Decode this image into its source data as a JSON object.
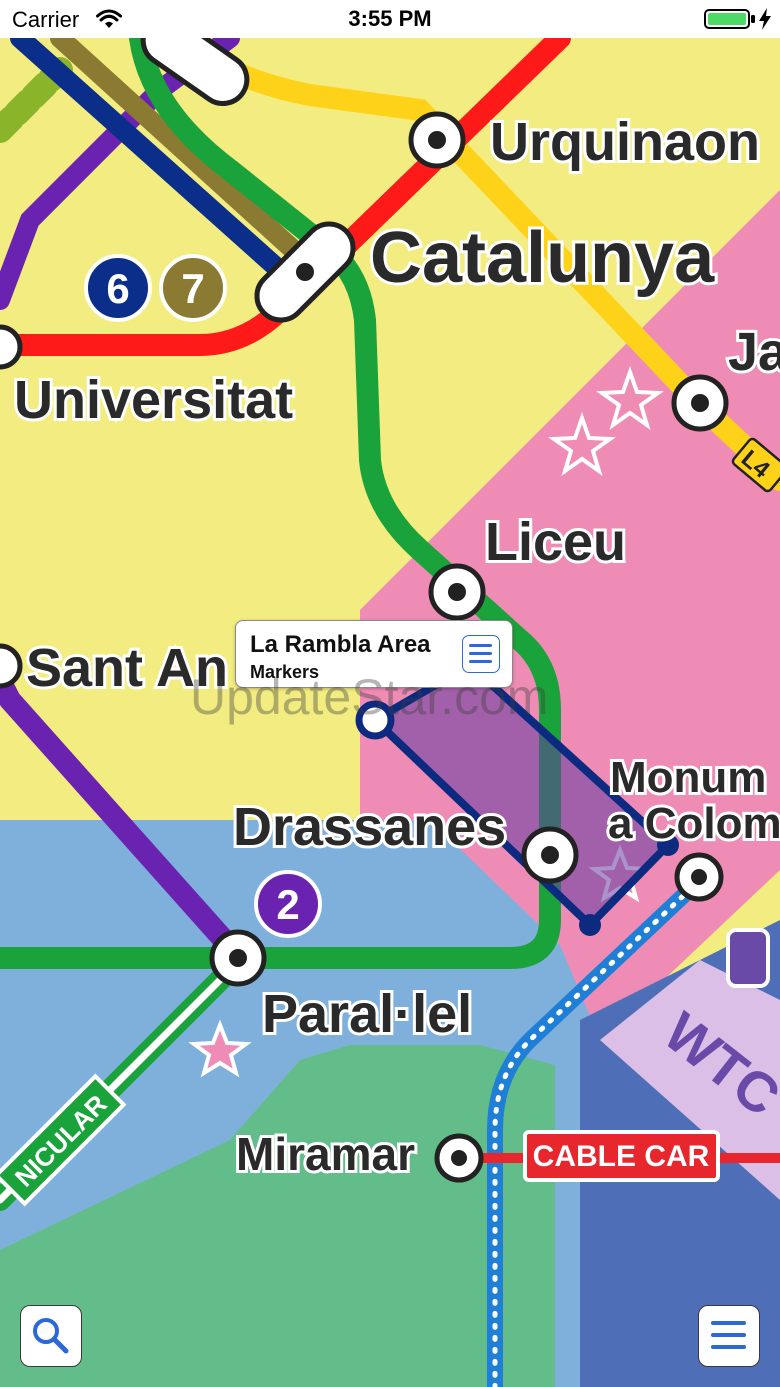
{
  "status_bar": {
    "carrier": "Carrier",
    "time": "3:55 PM"
  },
  "map": {
    "stations": {
      "urquinaona": "Urquinaon",
      "catalunya": "Catalunya",
      "universitat": "Universitat",
      "liceu": "Liceu",
      "sant_antoni": "Sant An",
      "drassanes": "Drassanes",
      "monument_1": "Monum",
      "monument_2": "a Colom",
      "parallel": "Paral·lel",
      "miramar": "Miramar",
      "jaume": "Ja"
    },
    "line_badges": {
      "l6": "6",
      "l7": "7",
      "l2": "2",
      "l4": "L4"
    },
    "labels": {
      "cable_car": "CABLE CAR",
      "funicular": "NICULAR",
      "wtc": "WTC"
    },
    "colors": {
      "land": "#f3ec80",
      "old_town": "#ef8cb6",
      "water": "#7fb0dc",
      "park": "#63bd8a",
      "port": "#4e6fb7",
      "wtc_zone": "#dcbfe6",
      "line_red": "#ff1a1a",
      "line_green": "#1aa33a",
      "line_yellow": "#ffd21a",
      "line_purple": "#6a22b0",
      "line_blue": "#0a2e8a",
      "line_olive": "#8a7a32",
      "line_lime": "#8ab52a",
      "line_cyan": "#1f7fd6",
      "marker_area": "#0c2a80"
    }
  },
  "callout": {
    "title": "La Rambla Area",
    "subtitle": "Markers",
    "icon": "list-icon"
  },
  "watermark": "UpdateStar.com",
  "controls": {
    "search_icon": "search-icon",
    "menu_icon": "menu-icon"
  }
}
